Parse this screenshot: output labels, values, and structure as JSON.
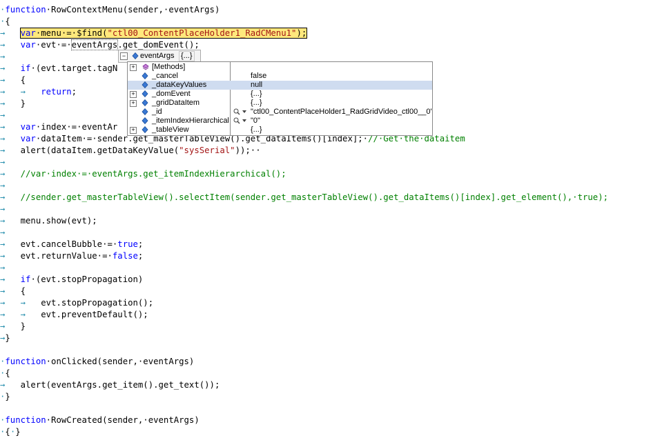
{
  "colors": {
    "keyword": "#0000ff",
    "string": "#a31515",
    "comment": "#008000",
    "whitespace": "#2b91af",
    "highlight": "#ffe87c"
  },
  "code": {
    "l01": {
      "kw": "function",
      "rest": "·RowContextMenu(sender,·eventArgs)"
    },
    "l02": {
      "text": "{"
    },
    "l03": {
      "kw": "var",
      "a": "·menu·=·$find(",
      "str": "\"ctl00_ContentPlaceHolder1_RadCMenu1\"",
      "b": ");"
    },
    "l04": {
      "kw": "var",
      "a": "·evt·=·",
      "obj": "eventArgs",
      "b": ".get_domEvent();"
    },
    "l06": {
      "kw": "if",
      "a": "·(evt.target.tagN"
    },
    "l07": {
      "text": "{"
    },
    "l08": {
      "kw": "return",
      "a": ";"
    },
    "l09": {
      "text": "}"
    },
    "l11": {
      "kw": "var",
      "a": "·index·=·eventAr"
    },
    "l12": {
      "kw": "var",
      "a": "·dataItem·=·sender.get_masterTableView().get_dataItems()[index];·",
      "cm": "//·Get·the·dataitem"
    },
    "l13": {
      "a": "alert(dataItem.getDataKeyValue(",
      "str": "\"sysSerial\"",
      "b": "));··"
    },
    "l15": {
      "cm": "//var·index·=·eventArgs.get_itemIndexHierarchical();"
    },
    "l17": {
      "cm": "//sender.get_masterTableView().selectItem(sender.get_masterTableView().get_dataItems()[index].get_element(),·true);"
    },
    "l19": {
      "a": "menu.show(evt);"
    },
    "l21": {
      "a": "evt.cancelBubble·=·",
      "kw": "true",
      "b": ";"
    },
    "l22": {
      "a": "evt.returnValue·=·",
      "kw": "false",
      "b": ";"
    },
    "l24": {
      "kw": "if",
      "a": "·(evt.stopPropagation)"
    },
    "l25": {
      "text": "{"
    },
    "l26": {
      "a": "evt.stopPropagation();"
    },
    "l27": {
      "a": "evt.preventDefault();"
    },
    "l28": {
      "text": "}"
    },
    "l29": {
      "text": "}"
    },
    "l31": {
      "kw": "function",
      "rest": "·onClicked(sender,·eventArgs)"
    },
    "l32": {
      "text": "{"
    },
    "l33": {
      "a": "alert(eventArgs.get_item().get_text());"
    },
    "l34": {
      "text": "}"
    },
    "l36": {
      "kw": "function",
      "rest": "·RowCreated(sender,·eventArgs)"
    },
    "l37": {
      "text": "{"
    },
    "l37b": {
      "text": "}"
    }
  },
  "tooltip": {
    "expander": "−",
    "name": "eventArgs",
    "value": "{...}"
  },
  "datatip": {
    "rows": [
      {
        "name": "[Methods]",
        "value": ""
      },
      {
        "name": "_cancel",
        "value": "false"
      },
      {
        "name": "_dataKeyValues",
        "value": "null"
      },
      {
        "name": "_domEvent",
        "value": "{...}"
      },
      {
        "name": "_gridDataItem",
        "value": "{...}"
      },
      {
        "name": "_id",
        "value": "\"ctl00_ContentPlaceHolder1_RadGridVideo_ctl00__0\""
      },
      {
        "name": "_itemIndexHierarchical",
        "value": "\"0\""
      },
      {
        "name": "_tableView",
        "value": "{...}"
      }
    ]
  }
}
